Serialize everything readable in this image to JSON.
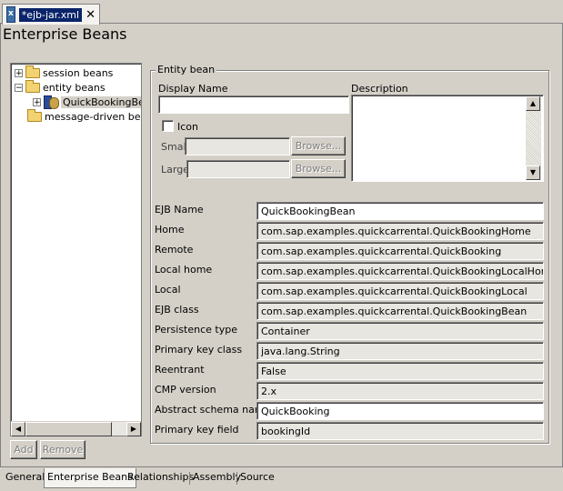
{
  "editor_tab": {
    "label": "*ejb-jar.xml",
    "close": "✕"
  },
  "page_title": "Enterprise Beans",
  "tree": {
    "items": [
      {
        "label": "session beans",
        "expander": "+"
      },
      {
        "label": "entity beans",
        "expander": "−"
      },
      {
        "label": "QuickBookingBean",
        "expander": "+"
      },
      {
        "label": "message-driven beans",
        "expander": ""
      }
    ]
  },
  "buttons": {
    "add": "Add",
    "remove": "Remove"
  },
  "group": {
    "legend": "Entity bean",
    "display_name_label": "Display Name",
    "display_name_value": "",
    "description_label": "Description",
    "icon_label": "Icon",
    "small_label": "Small",
    "large_label": "Large",
    "browse": "Browse..."
  },
  "fields": [
    {
      "label": "EJB Name",
      "value": "QuickBookingBean"
    },
    {
      "label": "Home",
      "value": "com.sap.examples.quickcarrental.QuickBookingHome"
    },
    {
      "label": "Remote",
      "value": "com.sap.examples.quickcarrental.QuickBooking"
    },
    {
      "label": "Local home",
      "value": "com.sap.examples.quickcarrental.QuickBookingLocalHome"
    },
    {
      "label": "Local",
      "value": "com.sap.examples.quickcarrental.QuickBookingLocal"
    },
    {
      "label": "EJB class",
      "value": "com.sap.examples.quickcarrental.QuickBookingBean"
    },
    {
      "label": "Persistence type",
      "value": "Container"
    },
    {
      "label": "Primary key class",
      "value": "java.lang.String"
    },
    {
      "label": "Reentrant",
      "value": "False"
    },
    {
      "label": "CMP version",
      "value": "2.x"
    },
    {
      "label": "Abstract schema name",
      "value": "QuickBooking"
    },
    {
      "label": "Primary key field",
      "value": "bookingId"
    }
  ],
  "bottom_tabs": [
    "General",
    "Enterprise Beans",
    "Relationships",
    "Assembly",
    "Source"
  ]
}
